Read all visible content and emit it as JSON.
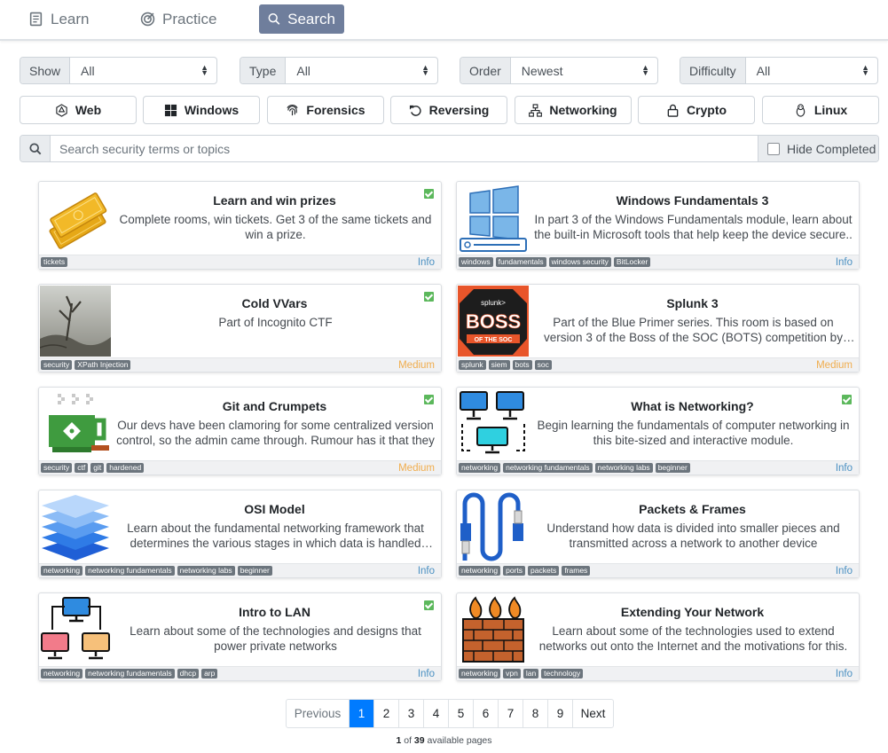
{
  "nav": [
    {
      "label": "Learn",
      "icon": "book-icon"
    },
    {
      "label": "Practice",
      "icon": "target-icon"
    },
    {
      "label": "Search",
      "icon": "search-icon"
    }
  ],
  "filters": [
    {
      "label": "Show",
      "value": "All"
    },
    {
      "label": "Type",
      "value": "All"
    },
    {
      "label": "Order",
      "value": "Newest"
    },
    {
      "label": "Difficulty",
      "value": "All"
    }
  ],
  "categories": [
    "Web",
    "Windows",
    "Forensics",
    "Reversing",
    "Networking",
    "Crypto",
    "Linux"
  ],
  "search": {
    "placeholder": "Search security terms or topics",
    "hide_completed": "Hide Completed"
  },
  "cards": [
    {
      "title": "Learn and win prizes",
      "desc": "Complete rooms, win tickets. Get 3 of the same tickets and win a prize.",
      "tags": [
        "tickets"
      ],
      "level": "Info",
      "completed": true
    },
    {
      "title": "Windows Fundamentals 3",
      "desc": "In part 3 of the Windows Fundamentals module, learn about the built-in Microsoft tools that help keep the device secure..",
      "tags": [
        "windows",
        "fundamentals",
        "windows security",
        "BitLocker"
      ],
      "level": "Info",
      "completed": false
    },
    {
      "title": "Cold VVars",
      "desc": "Part of Incognito CTF",
      "tags": [
        "security",
        "XPath Injection"
      ],
      "level": "Medium",
      "completed": true
    },
    {
      "title": "Splunk 3",
      "desc": "Part of the Blue Primer series. This room is based on version 3 of the Boss of the SOC (BOTS) competition by Splunk.",
      "tags": [
        "splunk",
        "siem",
        "bots",
        "soc"
      ],
      "level": "Medium",
      "completed": false
    },
    {
      "title": "Git and Crumpets",
      "desc": "Our devs have been clamoring for some centralized version control, so the admin came through. Rumour has it that they",
      "tags": [
        "security",
        "ctf",
        "git",
        "hardened"
      ],
      "level": "Medium",
      "completed": true
    },
    {
      "title": "What is Networking?",
      "desc": "Begin learning the fundamentals of computer networking in this bite-sized and interactive module.",
      "tags": [
        "networking",
        "networking fundamentals",
        "networking labs",
        "beginner"
      ],
      "level": "Info",
      "completed": true
    },
    {
      "title": "OSI Model",
      "desc": "Learn about the fundamental networking framework that determines the various stages in which data is handled across a network",
      "tags": [
        "networking",
        "networking fundamentals",
        "networking labs",
        "beginner"
      ],
      "level": "Info",
      "completed": false
    },
    {
      "title": "Packets & Frames",
      "desc": "Understand how data is divided into smaller pieces and transmitted across a network to another device",
      "tags": [
        "networking",
        "ports",
        "packets",
        "frames"
      ],
      "level": "Info",
      "completed": false
    },
    {
      "title": "Intro to LAN",
      "desc": "Learn about some of the technologies and designs that power private networks",
      "tags": [
        "networking",
        "networking fundamentals",
        "dhcp",
        "arp"
      ],
      "level": "Info",
      "completed": true
    },
    {
      "title": "Extending Your Network",
      "desc": "Learn about some of the technologies used to extend networks out onto the Internet and the motivations for this.",
      "tags": [
        "networking",
        "vpn",
        "lan",
        "technology"
      ],
      "level": "Info",
      "completed": false
    }
  ],
  "pagination": {
    "prev": "Previous",
    "pages": [
      "1",
      "2",
      "3",
      "4",
      "5",
      "6",
      "7",
      "8",
      "9"
    ],
    "next": "Next",
    "current": "1",
    "total": "39",
    "of_text": "of",
    "available_text": "available pages"
  },
  "colors": {
    "accent": "#007bff",
    "nav_active": "#6f7e9c",
    "check": "#5cb85c",
    "info": "#4a90c2",
    "medium": "#f0ad4e"
  }
}
